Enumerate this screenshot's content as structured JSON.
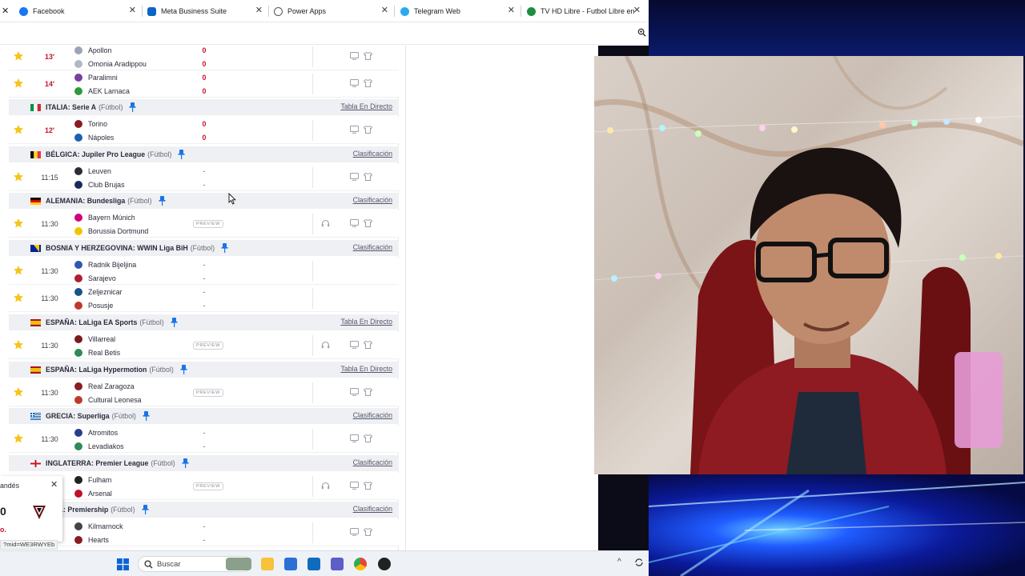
{
  "tabs": [
    {
      "title": "Facebook",
      "color": "#1877f2"
    },
    {
      "title": "Meta Business Suite",
      "color": "#0a66c2"
    },
    {
      "title": "Power Apps",
      "color": "#742774"
    },
    {
      "title": "Telegram Web",
      "color": "#2aabee"
    },
    {
      "title": "TV HD Libre - Futbol Libre en v",
      "color": "#1e8e3e"
    }
  ],
  "leagues": [
    {
      "name": "ITALIA: Serie A",
      "sport": "(Fútbol)",
      "link": "Tabla En Directo",
      "flag": "italy"
    },
    {
      "name": "BÉLGICA: Jupiler Pro League",
      "sport": "(Fútbol)",
      "link": "Clasificación",
      "flag": "belgium"
    },
    {
      "name": "ALEMANIA: Bundesliga",
      "sport": "(Fútbol)",
      "link": "Clasificación",
      "flag": "germany"
    },
    {
      "name": "BOSNIA Y HERZEGOVINA: WWIN Liga BiH",
      "sport": "(Fútbol)",
      "link": "Clasificación",
      "flag": "bosnia"
    },
    {
      "name": "ESPAÑA: LaLiga EA Sports",
      "sport": "(Fútbol)",
      "link": "Tabla En Directo",
      "flag": "spain"
    },
    {
      "name": "ESPAÑA: LaLiga Hypermotion",
      "sport": "(Fútbol)",
      "link": "Tabla En Directo",
      "flag": "spain"
    },
    {
      "name": "GRECIA: Superliga",
      "sport": "(Fútbol)",
      "link": "Clasificación",
      "flag": "greece"
    },
    {
      "name": "INGLATERRA: Premier League",
      "sport": "(Fútbol)",
      "link": "Clasificación",
      "flag": "england"
    },
    {
      "name": "OCIA: Premiership",
      "sport": "(Fútbol)",
      "link": "Clasificación",
      "flag": "none"
    }
  ],
  "matches": [
    {
      "time": "13'",
      "live": true,
      "home": "Apollon",
      "away": "Omonia Aradippou",
      "home_score": "0",
      "away_score": "0"
    },
    {
      "time": "14'",
      "live": true,
      "home": "Paralimni",
      "away": "AEK Larnaca",
      "home_score": "0",
      "away_score": "0"
    },
    {
      "time": "12'",
      "live": true,
      "home": "Torino",
      "away": "Nápoles",
      "home_score": "0",
      "away_score": "0"
    },
    {
      "time": "11:15",
      "live": false,
      "home": "Leuven",
      "away": "Club Brujas",
      "home_score": "-",
      "away_score": "-"
    },
    {
      "time": "11:30",
      "live": false,
      "home": "Bayern Múnich",
      "away": "Borussia Dortmund",
      "preview": "PREVIEW"
    },
    {
      "time": "11:30",
      "live": false,
      "home": "Radnik Bijeljina",
      "away": "Sarajevo",
      "home_score": "-",
      "away_score": "-"
    },
    {
      "time": "11:30",
      "live": false,
      "home": "Zeljeznicar",
      "away": "Posusje",
      "home_score": "-",
      "away_score": "-"
    },
    {
      "time": "11:30",
      "live": false,
      "home": "Villarreal",
      "away": "Real Betis",
      "preview": "PREVIEW"
    },
    {
      "time": "11:30",
      "live": false,
      "home": "Real Zaragoza",
      "away": "Cultural Leonesa",
      "preview": "PREVIEW"
    },
    {
      "time": "11:30",
      "live": false,
      "home": "Atromitos",
      "away": "Levadiakos",
      "home_score": "-",
      "away_score": "-"
    },
    {
      "time": "",
      "live": false,
      "home": "Fulham",
      "away": "Arsenal",
      "preview": "PREVIEW"
    },
    {
      "time": "",
      "live": false,
      "home": "Kilmarnock",
      "away": "Hearts",
      "home_score": "-",
      "away_score": "-"
    }
  ],
  "popup": {
    "text": "andés",
    "big": "0",
    "small": "o."
  },
  "status_url": "?mid=WE3RWYEb",
  "taskbar": {
    "search_placeholder": "Buscar"
  }
}
